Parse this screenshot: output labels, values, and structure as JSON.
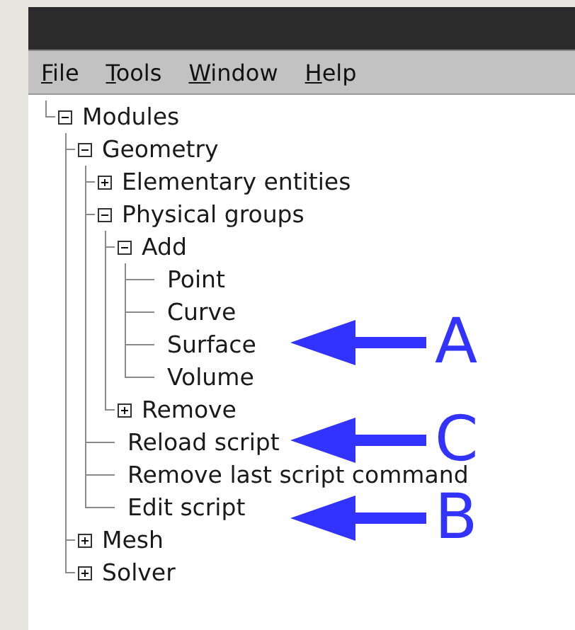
{
  "menu": [
    "File",
    "Tools",
    "Window",
    "Help"
  ],
  "tree": [
    {
      "label": "Modules",
      "expanded": true,
      "children": [
        {
          "label": "Geometry",
          "expanded": true,
          "children": [
            {
              "label": "Elementary entities",
              "expanded": false
            },
            {
              "label": "Physical groups",
              "expanded": true,
              "children": [
                {
                  "label": "Add",
                  "expanded": true,
                  "children": [
                    {
                      "label": "Point"
                    },
                    {
                      "label": "Curve"
                    },
                    {
                      "label": "Surface"
                    },
                    {
                      "label": "Volume"
                    }
                  ]
                },
                {
                  "label": "Remove",
                  "expanded": false
                }
              ]
            },
            {
              "label": "Reload script"
            },
            {
              "label": "Remove last script command"
            },
            {
              "label": "Edit script"
            }
          ]
        },
        {
          "label": "Mesh",
          "expanded": false
        },
        {
          "label": "Solver",
          "expanded": false
        }
      ]
    }
  ],
  "annotations": [
    {
      "label": "A"
    },
    {
      "label": "C"
    },
    {
      "label": "B"
    }
  ]
}
